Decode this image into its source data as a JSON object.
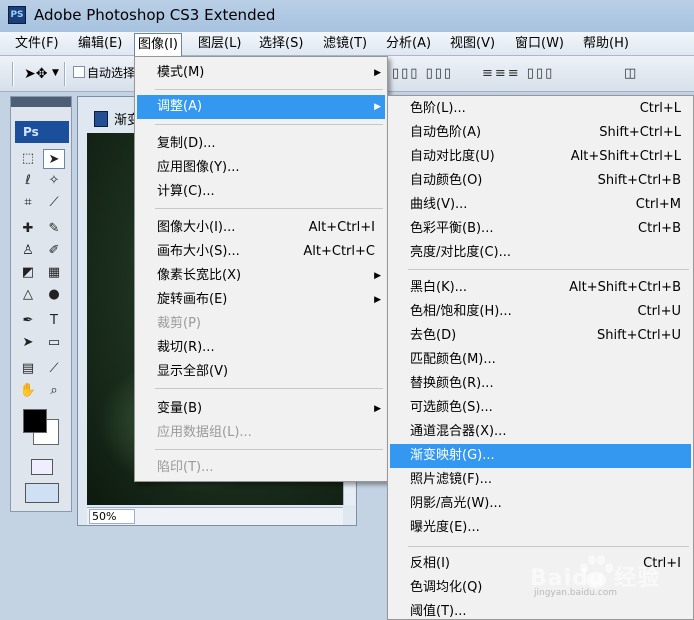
{
  "app": {
    "title": "Adobe Photoshop CS3 Extended",
    "logo": "PS"
  },
  "menubar": [
    "文件(F)",
    "编辑(E)",
    "图像(I)",
    "图层(L)",
    "选择(S)",
    "滤镜(T)",
    "分析(A)",
    "视图(V)",
    "窗口(W)",
    "帮助(H)"
  ],
  "options": {
    "auto_select_label": "自动选择"
  },
  "toolbox": {
    "logo": "Ps"
  },
  "document": {
    "title": "渐变",
    "zoom": "50%"
  },
  "image_menu": [
    {
      "label": "模式(M)",
      "submenu": true
    },
    {
      "label": "调整(A)",
      "submenu": true,
      "highlighted": true
    },
    {
      "label": "复制(D)..."
    },
    {
      "label": "应用图像(Y)..."
    },
    {
      "label": "计算(C)..."
    },
    {
      "label": "图像大小(I)...",
      "shortcut": "Alt+Ctrl+I"
    },
    {
      "label": "画布大小(S)...",
      "shortcut": "Alt+Ctrl+C"
    },
    {
      "label": "像素长宽比(X)",
      "submenu": true
    },
    {
      "label": "旋转画布(E)",
      "submenu": true
    },
    {
      "label": "裁剪(P)",
      "disabled": true
    },
    {
      "label": "裁切(R)..."
    },
    {
      "label": "显示全部(V)"
    },
    {
      "label": "变量(B)",
      "submenu": true
    },
    {
      "label": "应用数据组(L)...",
      "disabled": true
    },
    {
      "label": "陷印(T)...",
      "disabled": true
    }
  ],
  "adjust_menu": [
    {
      "label": "色阶(L)...",
      "shortcut": "Ctrl+L"
    },
    {
      "label": "自动色阶(A)",
      "shortcut": "Shift+Ctrl+L"
    },
    {
      "label": "自动对比度(U)",
      "shortcut": "Alt+Shift+Ctrl+L"
    },
    {
      "label": "自动颜色(O)",
      "shortcut": "Shift+Ctrl+B"
    },
    {
      "label": "曲线(V)...",
      "shortcut": "Ctrl+M"
    },
    {
      "label": "色彩平衡(B)...",
      "shortcut": "Ctrl+B"
    },
    {
      "label": "亮度/对比度(C)..."
    },
    {
      "label": "黑白(K)...",
      "shortcut": "Alt+Shift+Ctrl+B"
    },
    {
      "label": "色相/饱和度(H)...",
      "shortcut": "Ctrl+U"
    },
    {
      "label": "去色(D)",
      "shortcut": "Shift+Ctrl+U"
    },
    {
      "label": "匹配颜色(M)..."
    },
    {
      "label": "替换颜色(R)..."
    },
    {
      "label": "可选颜色(S)..."
    },
    {
      "label": "通道混合器(X)..."
    },
    {
      "label": "渐变映射(G)...",
      "highlighted": true
    },
    {
      "label": "照片滤镜(F)..."
    },
    {
      "label": "阴影/高光(W)..."
    },
    {
      "label": "曝光度(E)..."
    },
    {
      "label": "反相(I)",
      "shortcut": "Ctrl+I"
    },
    {
      "label": "色调均化(Q)"
    },
    {
      "label": "阈值(T)..."
    }
  ],
  "watermark": {
    "text": "Baidu 经验",
    "sub": "jingyan.baidu.com"
  },
  "colors": {
    "highlight": "#3498f0",
    "titlebar": "#a7c2df"
  }
}
